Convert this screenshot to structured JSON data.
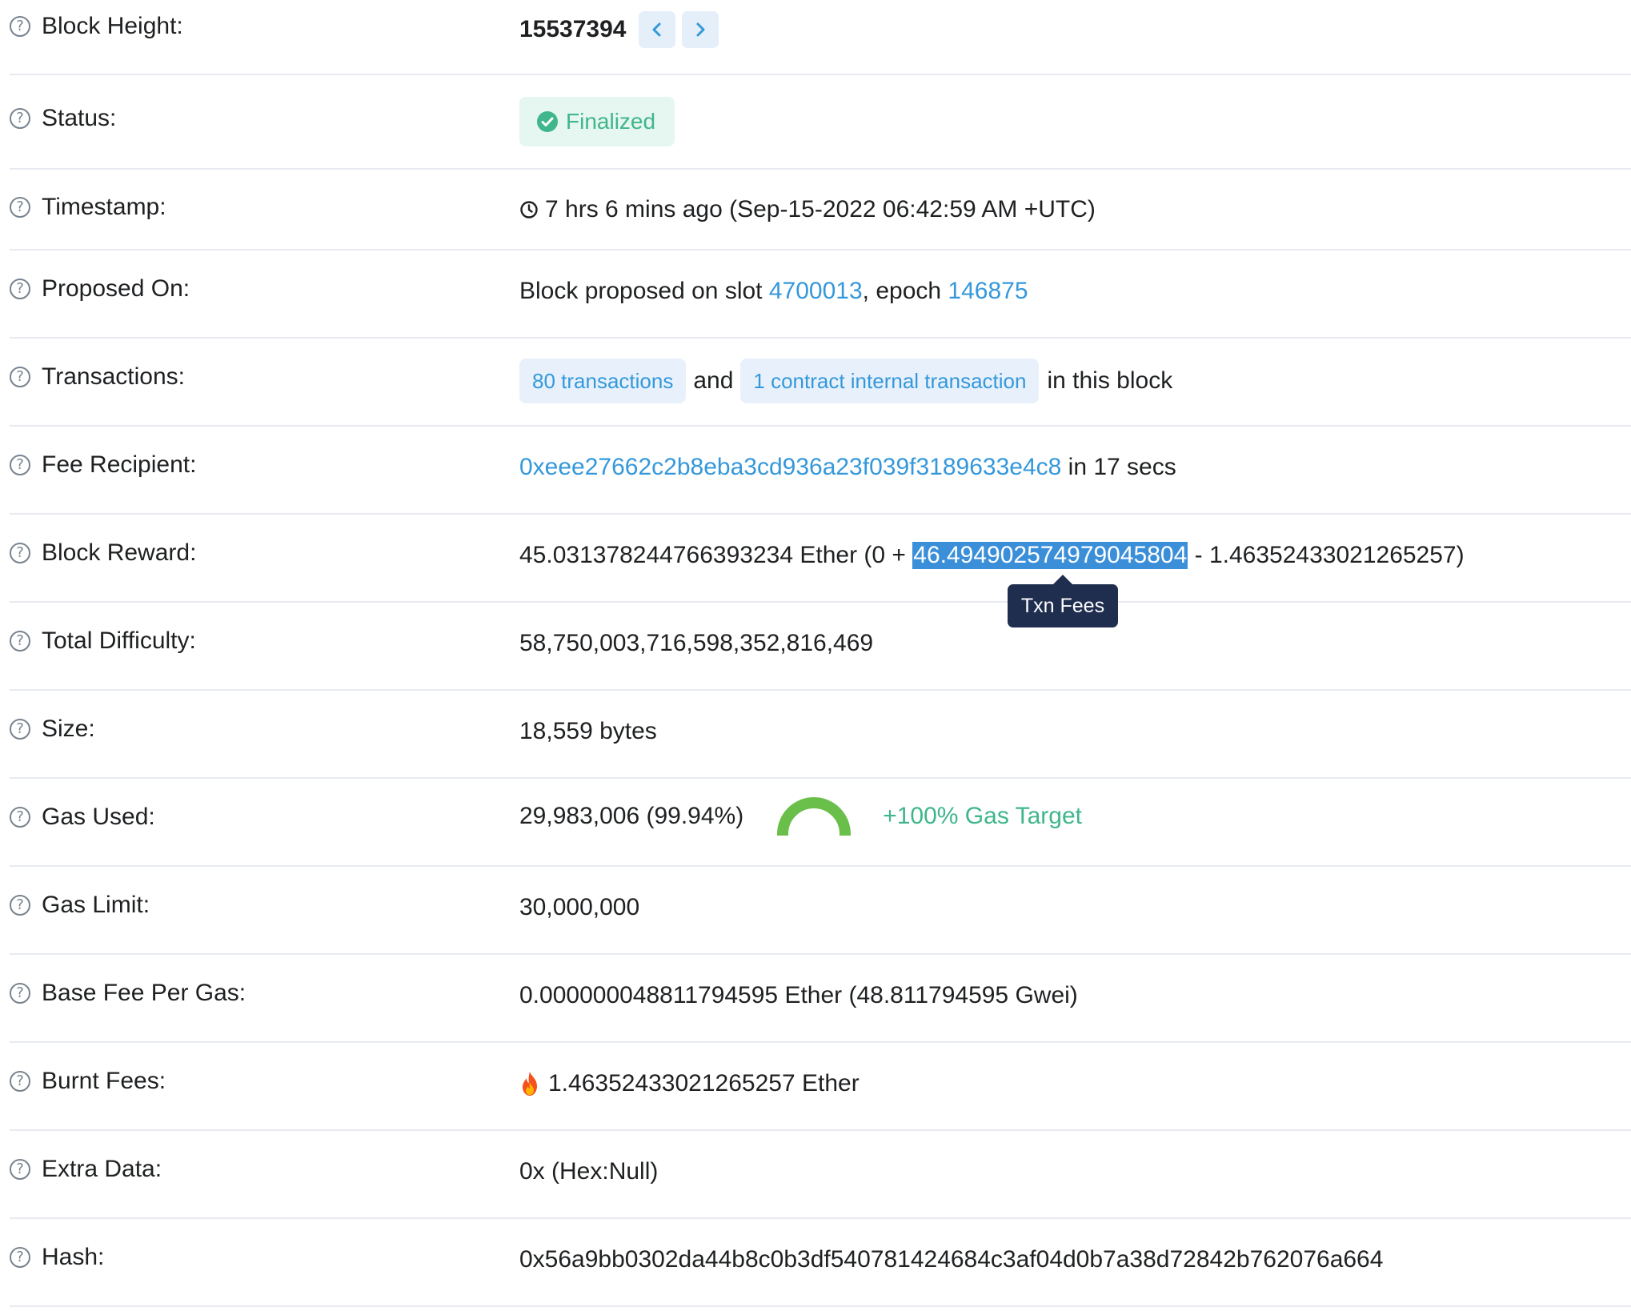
{
  "rows": [
    {
      "label": "Block Height:"
    },
    {
      "label": "Status:"
    },
    {
      "label": "Timestamp:"
    },
    {
      "label": "Proposed On:"
    },
    {
      "label": "Transactions:"
    },
    {
      "label": "Fee Recipient:"
    },
    {
      "label": "Block Reward:"
    },
    {
      "label": "Total Difficulty:"
    },
    {
      "label": "Size:"
    },
    {
      "label": "Gas Used:"
    },
    {
      "label": "Gas Limit:"
    },
    {
      "label": "Base Fee Per Gas:"
    },
    {
      "label": "Burnt Fees:"
    },
    {
      "label": "Extra Data:"
    },
    {
      "label": "Hash:"
    }
  ],
  "help_glyph": "?",
  "block_height": {
    "value": "15537394",
    "prev_icon": "chevron-left-icon",
    "next_icon": "chevron-right-icon"
  },
  "status": {
    "value": "Finalized",
    "icon": "check-circle-icon",
    "color": "#3fb68b"
  },
  "timestamp": {
    "value": "7 hrs 6 mins ago (Sep-15-2022 06:42:59 AM +UTC)",
    "icon": "clock-icon"
  },
  "proposed_on": {
    "prefix": "Block proposed on slot ",
    "slot": "4700013",
    "middle": ", epoch ",
    "epoch": "146875"
  },
  "transactions": {
    "txns": "80 transactions",
    "and": "and",
    "internal": "1 contract internal transaction",
    "suffix": "in this block"
  },
  "fee_recipient": {
    "address": "0xeee27662c2b8eba3cd936a23f039f3189633e4c8",
    "suffix": " in 17 secs"
  },
  "block_reward": {
    "prefix": "45.031378244766393234 Ether (0 + ",
    "highlight": "46.494902574979045804",
    "suffix": " - 1.46352433021265257)",
    "tooltip": "Txn Fees"
  },
  "total_difficulty": "58,750,003,716,598,352,816,469",
  "size": "18,559 bytes",
  "gas_used": {
    "value": "29,983,006 (99.94%)",
    "gauge_percent": 99.94,
    "target": "+100% Gas Target",
    "gauge_color": "#6abf4b"
  },
  "gas_limit": "30,000,000",
  "base_fee": "0.000000048811794595 Ether (48.811794595 Gwei)",
  "burnt_fees": {
    "icon": "fire-icon",
    "value": "1.46352433021265257 Ether"
  },
  "extra_data": "0x (Hex:Null)",
  "hash": "0x56a9bb0302da44b8c0b3df540781424684c3af04d0b7a38d72842b762076a664",
  "colors": {
    "link": "#3498db",
    "highlight": "#3b8fd9",
    "tooltip_bg": "#1f2d4f",
    "divider": "#e7eaf3"
  }
}
